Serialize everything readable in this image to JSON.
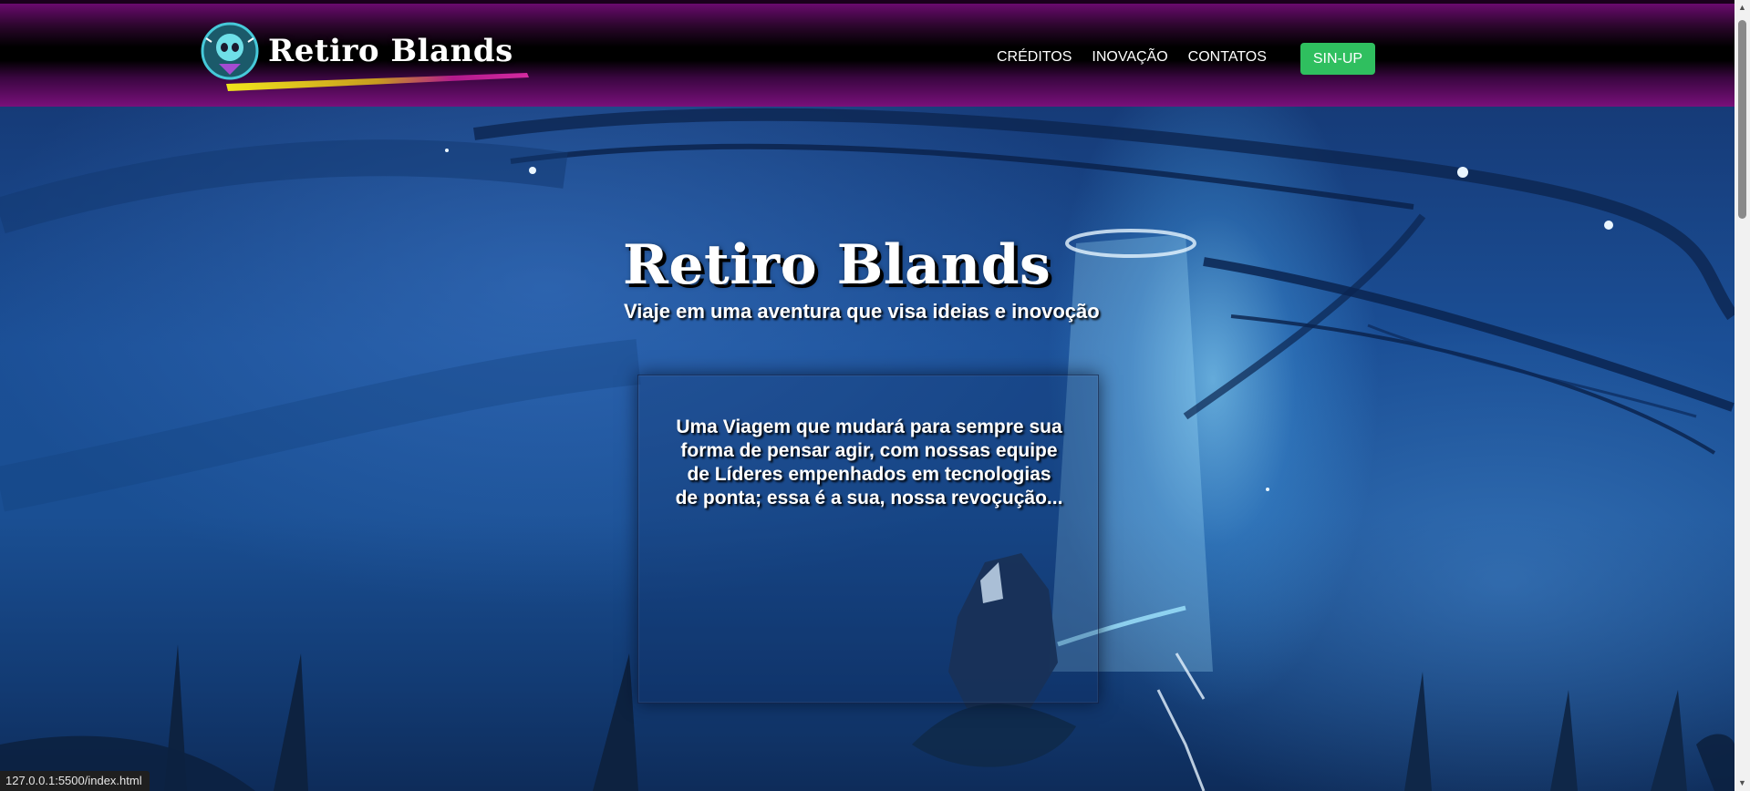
{
  "header": {
    "logo_text": "Retiro Blands",
    "nav": [
      {
        "label": "CRÉDITOS"
      },
      {
        "label": "INOVAÇÃO"
      },
      {
        "label": "CONTATOS"
      }
    ],
    "signup_label": "SIN-UP"
  },
  "hero": {
    "title": "Retiro Blands",
    "subtitle": "Viaje em uma aventura que visa ideias e inovoção",
    "card_text": "Uma Viagem que mudará para sempre sua forma de pensar agir, com nossas equipe de Líderes empenhados em tecnologias de ponta; essa é a sua, nossa revoçução..."
  },
  "status_bar": {
    "url": "127.0.0.1:5500/index.html"
  },
  "colors": {
    "header_purple": "#79107b",
    "signup_green": "#2fbf5f",
    "hero_blue": "#1b4f96"
  }
}
